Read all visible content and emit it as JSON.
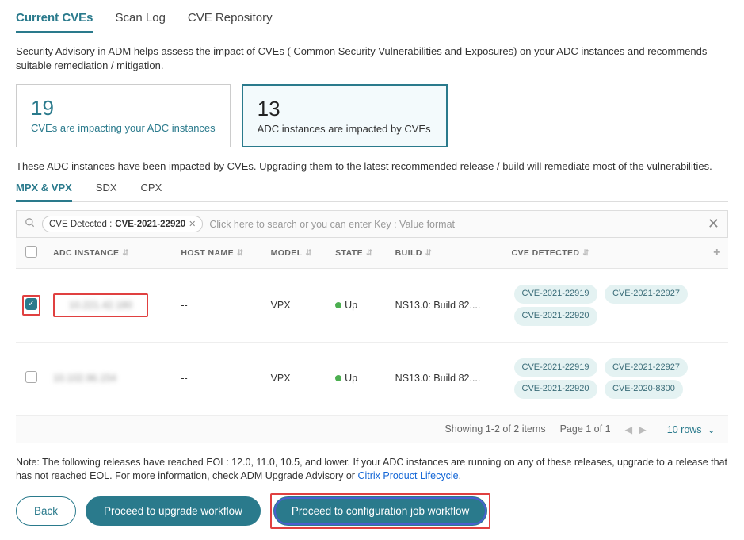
{
  "tabs": {
    "current": "Current CVEs",
    "scan": "Scan Log",
    "repo": "CVE Repository"
  },
  "intro": "Security Advisory in ADM helps assess the impact of CVEs ( Common Security Vulnerabilities and Exposures) on your ADC instances and recommends suitable remediation / mitigation.",
  "card1": {
    "num": "19",
    "label": "CVEs are impacting your ADC instances"
  },
  "card2": {
    "num": "13",
    "label": "ADC instances are impacted by CVEs"
  },
  "subintro": "These ADC instances have been impacted by CVEs. Upgrading them to the latest recommended release / build will remediate most of the vulnerabilities.",
  "subtabs": {
    "mpx": "MPX & VPX",
    "sdx": "SDX",
    "cpx": "CPX"
  },
  "search": {
    "chip_key": "CVE Detected : ",
    "chip_val": "CVE-2021-22920",
    "placeholder": "Click here to search or you can enter Key : Value format"
  },
  "cols": {
    "adc": "ADC INSTANCE",
    "host": "HOST NAME",
    "model": "MODEL",
    "state": "STATE",
    "build": "BUILD",
    "cve": "CVE DETECTED"
  },
  "rows": [
    {
      "checked": true,
      "adc": "10.221.42.180",
      "host": "--",
      "model": "VPX",
      "state": "Up",
      "build": "NS13.0: Build 82....",
      "cves": [
        "CVE-2021-22919",
        "CVE-2021-22927",
        "CVE-2021-22920"
      ]
    },
    {
      "checked": false,
      "adc": "10.102.96.154",
      "host": "--",
      "model": "VPX",
      "state": "Up",
      "build": "NS13.0: Build 82....",
      "cves": [
        "CVE-2021-22919",
        "CVE-2021-22927",
        "CVE-2021-22920",
        "CVE-2020-8300"
      ]
    }
  ],
  "pager": {
    "showing": "Showing 1-2 of 2 items",
    "page": "Page 1 of 1",
    "rows": "10 rows"
  },
  "note_text": "Note: The following releases have reached EOL: 12.0, 11.0, 10.5, and lower. If your ADC instances are running on any of these releases, upgrade to a release that has not reached EOL. For more information, check ADM Upgrade Advisory or ",
  "note_link": "Citrix Product Lifecycle",
  "note_period": ".",
  "buttons": {
    "back": "Back",
    "upgrade": "Proceed to upgrade workflow",
    "config": "Proceed to configuration job workflow"
  }
}
